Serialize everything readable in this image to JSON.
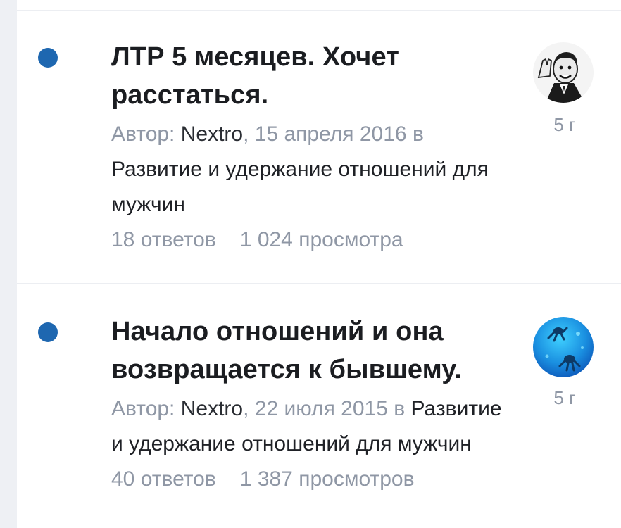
{
  "topics": [
    {
      "title": "ЛТР 5 месяцев. Хочет расстаться.",
      "author_prefix": "Автор:",
      "author": "Nextro",
      "date": ", 15 апреля 2016 в",
      "forum": "Развитие и удержание отношений для мужчин",
      "replies": "18 ответов",
      "views": "1 024 просмотра",
      "last_post_time": "5 г",
      "avatar_icon": "retro-man-avatar-icon"
    },
    {
      "title": "Начало отношений и она возвращается к бывшему.",
      "author_prefix": "Автор:",
      "author": "Nextro",
      "date": ", 22 июля 2015 в",
      "forum": "Развитие и удержание отношений для мужчин",
      "replies": "40 ответов",
      "views": "1 387 просмотров",
      "last_post_time": "5 г",
      "avatar_icon": "underwater-divers-avatar-icon"
    }
  ],
  "colors": {
    "unread_dot": "#1e67b0",
    "muted_text": "#8f97a5",
    "title_text": "#1b1d21"
  }
}
